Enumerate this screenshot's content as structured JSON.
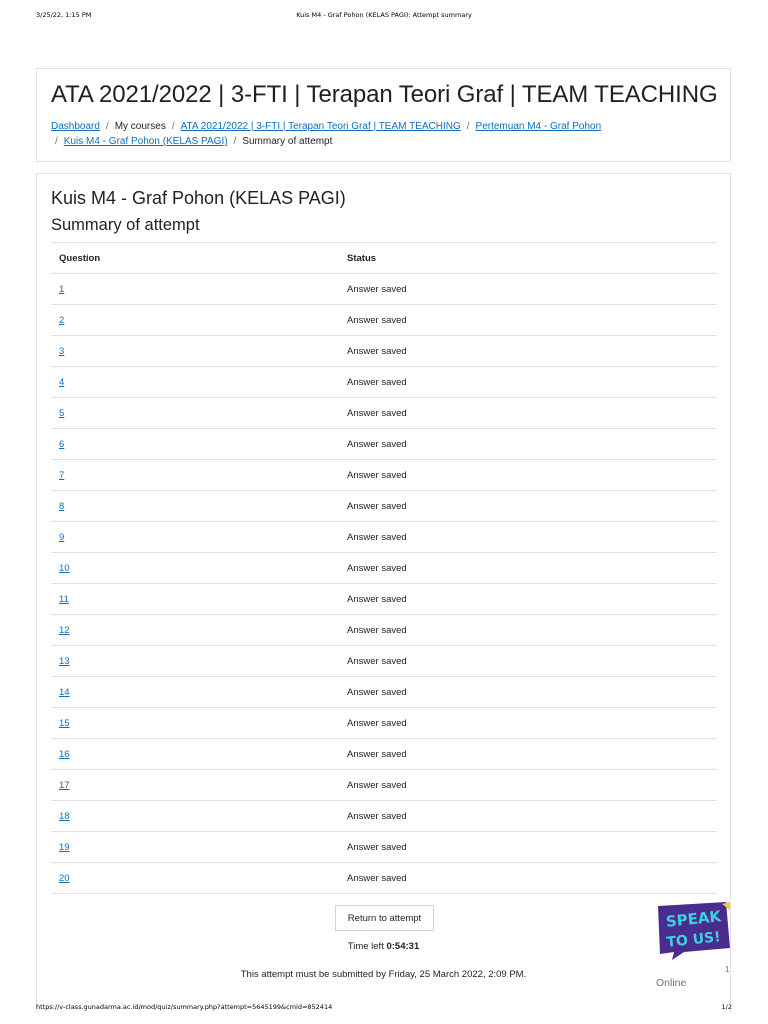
{
  "print": {
    "datetime": "3/25/22, 1:15 PM",
    "doc_title": "Kuis M4 - Graf Pohon (KELAS PAGI): Attempt summary",
    "url": "https://v-class.gunadarma.ac.id/mod/quiz/summary.php?attempt=5645199&cmid=852414",
    "page": "1/2"
  },
  "header": {
    "course_title": "ATA 2021/2022 | 3-FTI | Terapan Teori Graf | TEAM TEACHING",
    "breadcrumb": {
      "dashboard": "Dashboard",
      "my_courses": "My courses",
      "course": "ATA 2021/2022 | 3-FTI | Terapan Teori Graf | TEAM TEACHING",
      "section": "Pertemuan M4 - Graf Pohon",
      "quiz": "Kuis M4 - Graf Pohon (KELAS PAGI)",
      "current": "Summary of attempt",
      "separator": "/"
    }
  },
  "main": {
    "quiz_title": "Kuis M4 - Graf Pohon (KELAS PAGI)",
    "summary_title": "Summary of attempt",
    "table": {
      "col_question": "Question",
      "col_status": "Status",
      "rows": [
        {
          "q": "1",
          "status": "Answer saved"
        },
        {
          "q": "2",
          "status": "Answer saved"
        },
        {
          "q": "3",
          "status": "Answer saved"
        },
        {
          "q": "4",
          "status": "Answer saved"
        },
        {
          "q": "5",
          "status": "Answer saved"
        },
        {
          "q": "6",
          "status": "Answer saved"
        },
        {
          "q": "7",
          "status": "Answer saved"
        },
        {
          "q": "8",
          "status": "Answer saved"
        },
        {
          "q": "9",
          "status": "Answer saved"
        },
        {
          "q": "10",
          "status": "Answer saved"
        },
        {
          "q": "11",
          "status": "Answer saved"
        },
        {
          "q": "12",
          "status": "Answer saved"
        },
        {
          "q": "13",
          "status": "Answer saved"
        },
        {
          "q": "14",
          "status": "Answer saved"
        },
        {
          "q": "15",
          "status": "Answer saved"
        },
        {
          "q": "16",
          "status": "Answer saved"
        },
        {
          "q": "17",
          "status": "Answer saved"
        },
        {
          "q": "18",
          "status": "Answer saved"
        },
        {
          "q": "19",
          "status": "Answer saved"
        },
        {
          "q": "20",
          "status": "Answer saved"
        }
      ]
    },
    "return_button": "Return to attempt",
    "time_left_label": "Time left",
    "time_left_value": "0:54:31",
    "submit_note": "This attempt must be submitted by Friday, 25 March 2022, 2:09 PM."
  },
  "widget": {
    "speak_line1": "SPEAK",
    "speak_line2": "TO US!",
    "online": "Online",
    "counter": "1"
  },
  "colors": {
    "link": "#0f6cbf",
    "border": "#dee2e6",
    "badge_bg": "#4a2c8f",
    "badge_text": "#3fd1e0"
  }
}
